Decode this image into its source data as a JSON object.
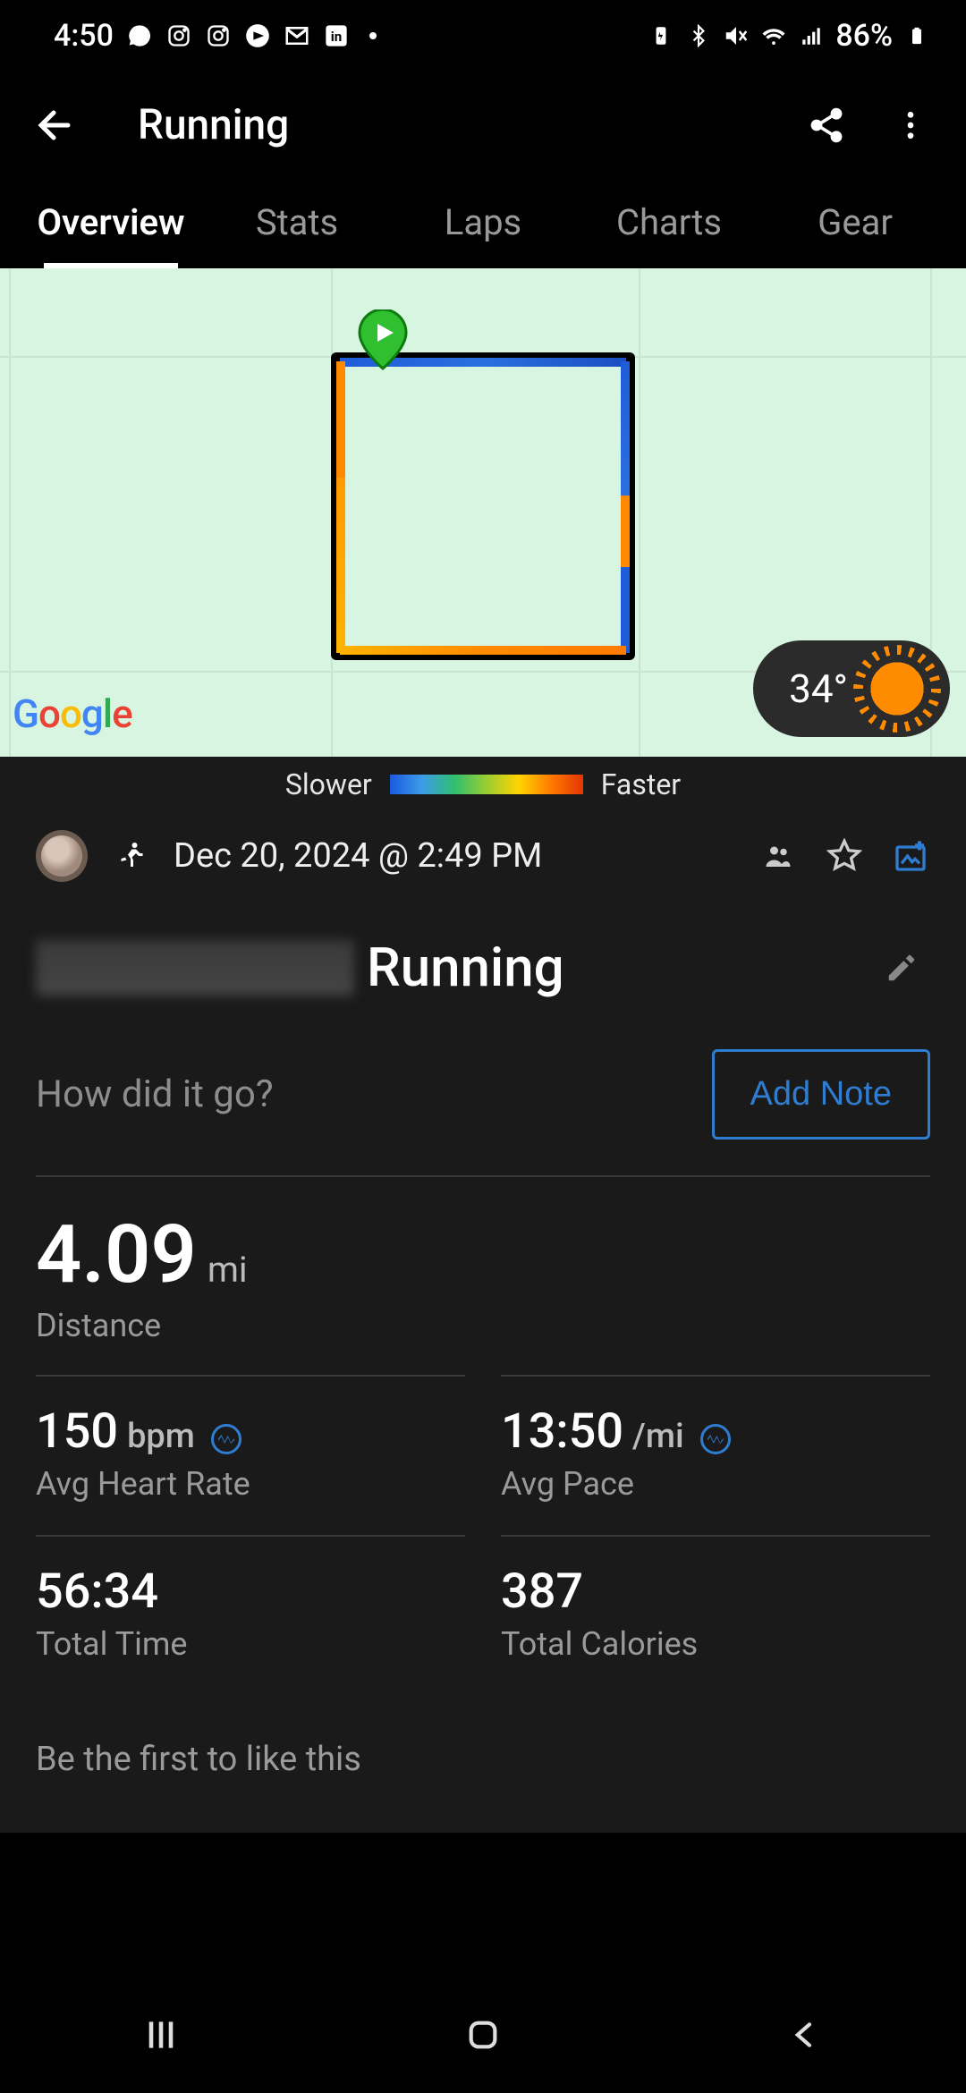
{
  "status": {
    "time": "4:50",
    "battery": "86%"
  },
  "header": {
    "title": "Running"
  },
  "tabs": [
    {
      "label": "Overview",
      "active": true
    },
    {
      "label": "Stats",
      "active": false
    },
    {
      "label": "Laps",
      "active": false
    },
    {
      "label": "Charts",
      "active": false
    },
    {
      "label": "Gear",
      "active": false
    }
  ],
  "map": {
    "attribution": "Google",
    "weather": {
      "temp": "34°"
    },
    "legend": {
      "slower": "Slower",
      "faster": "Faster"
    }
  },
  "activity": {
    "timestamp": "Dec 20, 2024 @ 2:49 PM",
    "name": "Running",
    "note_prompt": "How did it go?",
    "add_note_label": "Add Note"
  },
  "stats": {
    "distance": {
      "value": "4.09",
      "unit": "mi",
      "label": "Distance"
    },
    "avg_hr": {
      "value": "150",
      "unit": "bpm",
      "label": "Avg Heart Rate"
    },
    "avg_pace": {
      "value": "13:50",
      "unit": "/mi",
      "label": "Avg Pace"
    },
    "total_time": {
      "value": "56:34",
      "label": "Total Time"
    },
    "calories": {
      "value": "387",
      "label": "Total Calories"
    }
  },
  "social": {
    "likes_prompt": "Be the first to like this"
  }
}
